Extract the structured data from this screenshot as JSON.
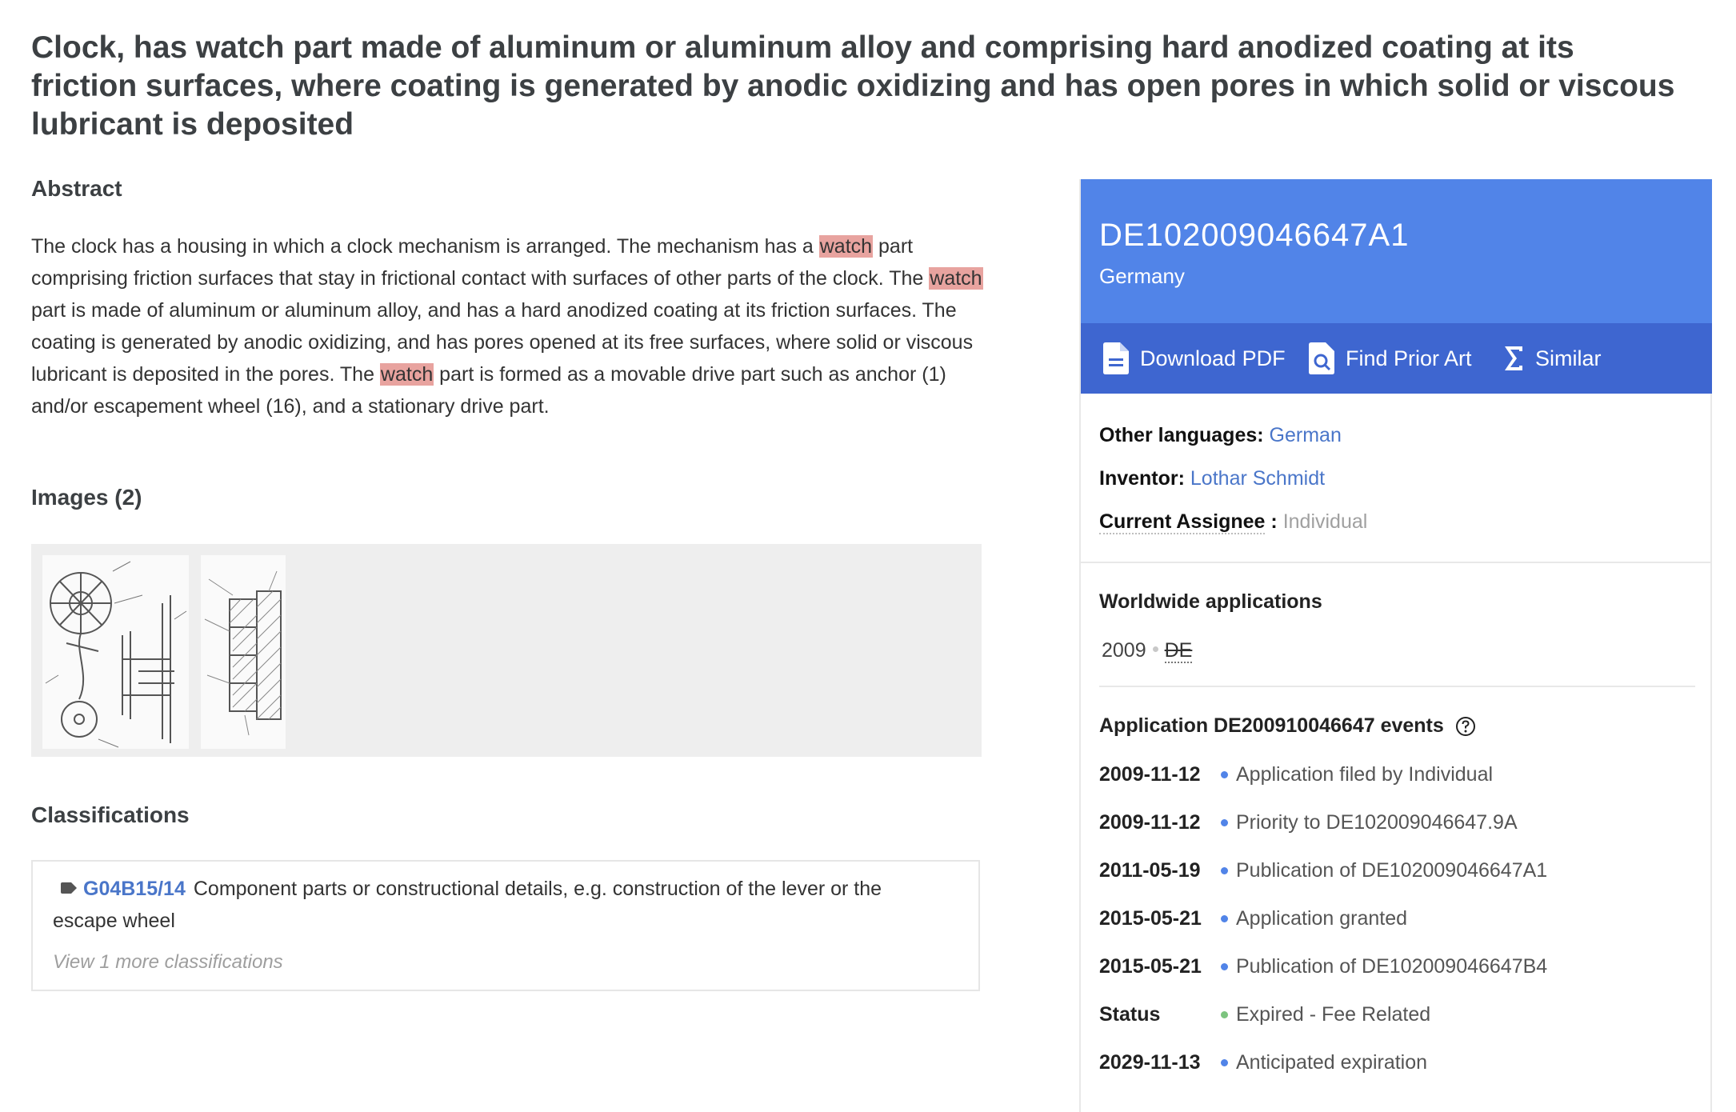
{
  "title": "Clock, has watch part made of aluminum or aluminum alloy and comprising hard anodized coating at its friction surfaces, where coating is generated by anodic oxidizing and has open pores in which solid or viscous lubricant is deposited",
  "abstract": {
    "heading": "Abstract",
    "parts": [
      "The clock has a housing in which a clock mechanism is arranged. The mechanism has a ",
      "watch",
      " part comprising friction surfaces that stay in frictional contact with surfaces of other parts of the clock. The ",
      "watch",
      " part is made of aluminum or aluminum alloy, and has a hard anodized coating at its friction surfaces. The coating is generated by anodic oxidizing, and has pores opened at its free surfaces, where solid or viscous lubricant is deposited in the pores. The ",
      "watch",
      " part is formed as a movable drive part such as anchor (1) and/or escapement wheel (16), and a stationary drive part."
    ]
  },
  "images": {
    "heading": "Images (2)"
  },
  "classifications": {
    "heading": "Classifications",
    "code": "G04B15/14",
    "description": "Component parts or constructional details, e.g. construction of the lever or the escape wheel",
    "more": "View 1 more classifications"
  },
  "sidebar": {
    "pub_number": "DE102009046647A1",
    "country": "Germany",
    "actions": {
      "download": "Download PDF",
      "prior_art": "Find Prior Art",
      "similar": "Similar"
    },
    "other_languages_label": "Other languages:",
    "other_languages_value": "German",
    "inventor_label": "Inventor:",
    "inventor_value": "Lothar Schmidt",
    "assignee_label": "Current Assignee",
    "assignee_sep": " : ",
    "assignee_value": "Individual",
    "worldwide_heading": "Worldwide applications",
    "worldwide_year": "2009",
    "worldwide_country": "DE",
    "events_heading": "Application DE200910046647 events",
    "events": [
      {
        "date": "2009-11-12",
        "text": "Application filed by Individual",
        "dot": "#5184e8"
      },
      {
        "date": "2009-11-12",
        "text": "Priority to DE102009046647.9A",
        "dot": "#5184e8"
      },
      {
        "date": "2011-05-19",
        "text": "Publication of DE102009046647A1",
        "dot": "#5184e8"
      },
      {
        "date": "2015-05-21",
        "text": "Application granted",
        "dot": "#5184e8"
      },
      {
        "date": "2015-05-21",
        "text": "Publication of DE102009046647B4",
        "dot": "#5184e8"
      },
      {
        "date": "Status",
        "text": "Expired - Fee Related",
        "dot": "#7cc47f"
      },
      {
        "date": "2029-11-13",
        "text": "Anticipated expiration",
        "dot": "#5184e8"
      }
    ]
  }
}
